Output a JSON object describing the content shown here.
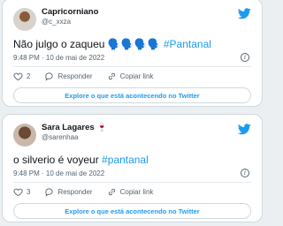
{
  "colors": {
    "accent": "#1d9bf0",
    "secondary_text": "#536471",
    "border": "#cfd9de",
    "background": "#eceff1"
  },
  "tweets": [
    {
      "name": "Capricorniano",
      "name_emoji": "",
      "handle": "@c_xxza",
      "text": "Não julgo o zaqueu 🗣️🗣️🗣️🗣️ ",
      "hashtag": "#Pantanal",
      "time": "9:48 PM · 10 de mai de 2022",
      "likes": "2",
      "reply_label": "Responder",
      "copy_label": "Copiar link",
      "explore_label": "Explore o que está acontecendo no Twitter",
      "avatar_icon": "user-avatar-icon"
    },
    {
      "name": "Sara Lagares",
      "name_emoji": "🍷",
      "handle": "@sarenhaa",
      "text": "o silverio é voyeur ",
      "hashtag": "#pantanal",
      "time": "9:48 PM · 10 de mai de 2022",
      "likes": "3",
      "reply_label": "Responder",
      "copy_label": "Copiar link",
      "explore_label": "Explore o que está acontecendo no Twitter",
      "avatar_icon": "user-avatar-icon"
    }
  ]
}
